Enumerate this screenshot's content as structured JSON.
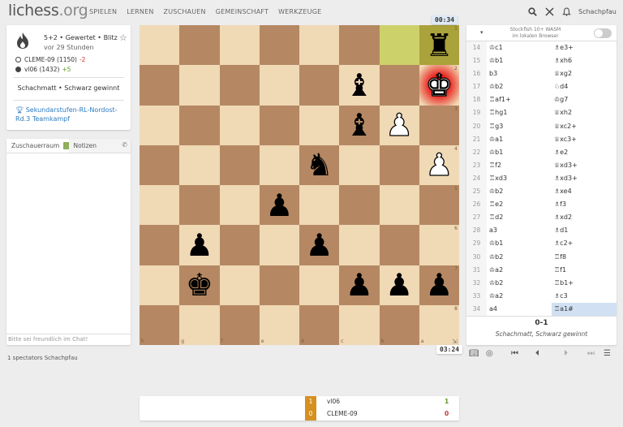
{
  "header": {
    "logo_main": "lichess",
    "logo_tld": ".org",
    "nav": [
      "SPIELEN",
      "LERNEN",
      "ZUSCHAUEN",
      "GEMEINSCHAFT",
      "WERKZEUGE"
    ],
    "username": "Schachpfau"
  },
  "game": {
    "mode": "5+2 • Gewertet • Blitz",
    "ago": "vor 29 Stunden",
    "white_player": "CLEME-09 (1150)",
    "white_diff": "-2",
    "black_player": "vl06 (1432)",
    "black_diff": "+5",
    "result": "Schachmatt • Schwarz gewinnt",
    "tournament_line1": "Sekundarstufen-RL-Nordost-",
    "tournament_line2": "Rd.3 Teamkampf"
  },
  "chat": {
    "tab_room": "Zuschauerraum",
    "tab_notes": "Notizen",
    "placeholder": "Bitte sei freundlich im Chat!",
    "spectators": "1 spectators Schachpfau"
  },
  "clocks": {
    "top": "00:34",
    "bottom": "03:24"
  },
  "board": {
    "files": [
      "h",
      "g",
      "f",
      "e",
      "d",
      "c",
      "b",
      "a"
    ],
    "ranks": [
      "1",
      "2",
      "3",
      "4",
      "5",
      "6",
      "7",
      "8"
    ],
    "pieces": [
      {
        "row": 0,
        "col": 7,
        "glyph": "♜",
        "color": "b"
      },
      {
        "row": 1,
        "col": 5,
        "glyph": "♝",
        "color": "b"
      },
      {
        "row": 1,
        "col": 7,
        "glyph": "♚",
        "color": "w"
      },
      {
        "row": 2,
        "col": 5,
        "glyph": "♝",
        "color": "b"
      },
      {
        "row": 2,
        "col": 6,
        "glyph": "♟",
        "color": "w"
      },
      {
        "row": 3,
        "col": 4,
        "glyph": "♞",
        "color": "b"
      },
      {
        "row": 3,
        "col": 7,
        "glyph": "♟",
        "color": "w"
      },
      {
        "row": 4,
        "col": 3,
        "glyph": "♟",
        "color": "b"
      },
      {
        "row": 5,
        "col": 1,
        "glyph": "♟",
        "color": "b"
      },
      {
        "row": 5,
        "col": 4,
        "glyph": "♟",
        "color": "b"
      },
      {
        "row": 6,
        "col": 1,
        "glyph": "♚",
        "color": "b"
      },
      {
        "row": 6,
        "col": 5,
        "glyph": "♟",
        "color": "b"
      },
      {
        "row": 6,
        "col": 6,
        "glyph": "♟",
        "color": "b"
      },
      {
        "row": 6,
        "col": 7,
        "glyph": "♟",
        "color": "b"
      }
    ],
    "last_move": [
      {
        "row": 0,
        "col": 6
      },
      {
        "row": 0,
        "col": 7
      }
    ],
    "check": {
      "row": 1,
      "col": 7
    }
  },
  "engine": {
    "name_line1": "Stockfish 10+ WASM",
    "name_line2": "im lokalen Browser"
  },
  "moves": [
    {
      "n": "14",
      "w": "♔c1",
      "b": "♗e3+"
    },
    {
      "n": "15",
      "w": "♔b1",
      "b": "♗xh6"
    },
    {
      "n": "16",
      "w": "b3",
      "b": "♕xg2"
    },
    {
      "n": "17",
      "w": "♔b2",
      "b": "♘d4"
    },
    {
      "n": "18",
      "w": "♖af1+",
      "b": "♔g7"
    },
    {
      "n": "19",
      "w": "♖hg1",
      "b": "♕xh2"
    },
    {
      "n": "20",
      "w": "♖g3",
      "b": "♕xc2+"
    },
    {
      "n": "21",
      "w": "♔a1",
      "b": "♕xc3+"
    },
    {
      "n": "22",
      "w": "♔b1",
      "b": "♗e2"
    },
    {
      "n": "23",
      "w": "♖f2",
      "b": "♕xd3+"
    },
    {
      "n": "24",
      "w": "♖xd3",
      "b": "♗xd3+"
    },
    {
      "n": "25",
      "w": "♔b2",
      "b": "♗xe4"
    },
    {
      "n": "26",
      "w": "♖e2",
      "b": "♗f3"
    },
    {
      "n": "27",
      "w": "♖d2",
      "b": "♗xd2"
    },
    {
      "n": "28",
      "w": "a3",
      "b": "♗d1"
    },
    {
      "n": "29",
      "w": "♔b1",
      "b": "♗c2+"
    },
    {
      "n": "30",
      "w": "♔b2",
      "b": "♖f8"
    },
    {
      "n": "31",
      "w": "♔a2",
      "b": "♖f1"
    },
    {
      "n": "32",
      "w": "♔b2",
      "b": "♖b1+"
    },
    {
      "n": "33",
      "w": "♔a2",
      "b": "♗c3"
    },
    {
      "n": "34",
      "w": "a4",
      "b": "♖a1#"
    }
  ],
  "score": {
    "result": "0-1",
    "text": "Schachmatt, Schwarz gewinnt"
  },
  "team": {
    "rows": [
      {
        "num": "1",
        "name": "vl06",
        "score": "1",
        "num_color": "#d59020",
        "score_color": "#629924"
      },
      {
        "num": "0",
        "name": "CLEME-09",
        "score": "0",
        "num_color": "#d59020",
        "score_color": "#c33"
      }
    ]
  }
}
